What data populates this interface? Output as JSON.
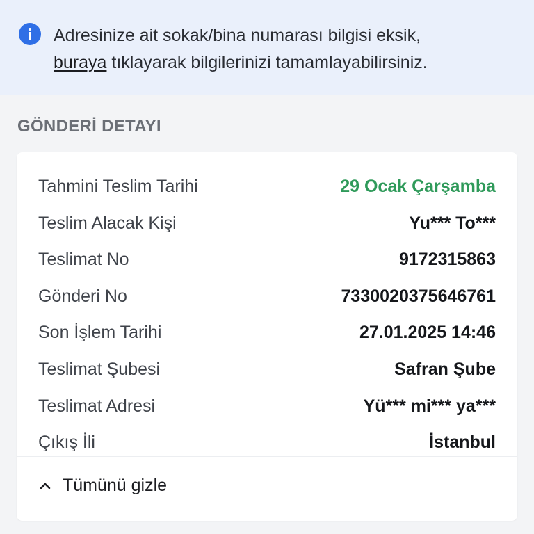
{
  "notice": {
    "text_before": "Adresinize ait sokak/bina numarası bilgisi eksik, ",
    "link_text": "buraya",
    "text_after": " tıklayarak bilgilerinizi tamamlayabilirsiniz.",
    "icon": "info-icon",
    "accent_color": "#2f6fe6",
    "background": "#eaf0fb"
  },
  "section_title": "GÖNDERİ DETAYI",
  "details": [
    {
      "label": "Tahmini Teslim Tarihi",
      "value": "29 Ocak Çarşamba",
      "value_color": "#2f9a5a"
    },
    {
      "label": "Teslim Alacak Kişi",
      "value": "Yu*** To***"
    },
    {
      "label": "Teslimat No",
      "value": "9172315863"
    },
    {
      "label": "Gönderi No",
      "value": "7330020375646761"
    },
    {
      "label": "Son İşlem Tarihi",
      "value": "27.01.2025 14:46"
    },
    {
      "label": "Teslimat Şubesi",
      "value": "Safran Şube"
    },
    {
      "label": "Teslimat Adresi",
      "value": "Yü*** mi*** ya***"
    },
    {
      "label": "Çıkış İli",
      "value": "İstanbul"
    }
  ],
  "toggle": {
    "label": "Tümünü gizle",
    "icon": "chevron-up-icon"
  }
}
